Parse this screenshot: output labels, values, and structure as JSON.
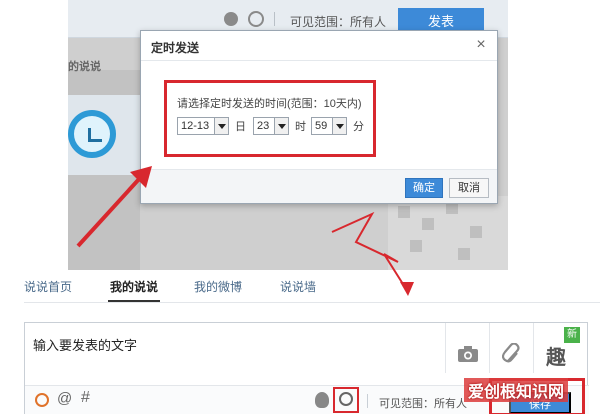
{
  "top_bar": {
    "visibility_text": "可见范围：所有人",
    "publish_label": "发表"
  },
  "left_panel": {
    "label": "的说说"
  },
  "dialog": {
    "title": "定时发送",
    "close_symbol": "×",
    "hint": "请选择定时发送的时间(范围：10天内)",
    "date_value": "12-13",
    "date_unit": "日",
    "hour_value": "23",
    "hour_unit": "时",
    "minute_value": "59",
    "minute_unit": "分",
    "confirm_label": "确定",
    "cancel_label": "取消"
  },
  "tabs": [
    {
      "label": "说说首页"
    },
    {
      "label": "我的说说",
      "active": true
    },
    {
      "label": "我的微博"
    },
    {
      "label": "说说墙"
    }
  ],
  "editor": {
    "text": "输入要发表的文字",
    "tools": [
      "camera-icon",
      "attachment-icon",
      "fun-icon"
    ],
    "fun_badge": "新",
    "fun_glyph": "趣",
    "visibility_text": "可见范围：所有人",
    "save_label": "保存",
    "at_symbol": "@",
    "hash_symbol": "#"
  },
  "watermark": "爱创根知识网",
  "colors": {
    "accent": "#3d8ad8",
    "highlight": "#d8282e"
  }
}
